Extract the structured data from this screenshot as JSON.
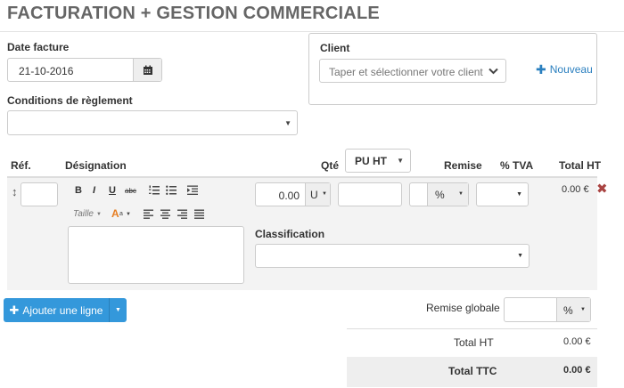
{
  "header": {
    "title": "FACTURATION + GESTION COMMERCIALE"
  },
  "invoice": {
    "date_label": "Date facture",
    "date_value": "21-10-2016",
    "conditions_label": "Conditions de règlement",
    "conditions_value": ""
  },
  "client": {
    "label": "Client",
    "placeholder": "Taper et sélectionner votre client",
    "new_link": "Nouveau"
  },
  "table": {
    "headers": {
      "ref": "Réf.",
      "designation": "Désignation",
      "qty": "Qté",
      "pu_select": "PU HT",
      "remise": "Remise",
      "tva": "% TVA",
      "total": "Total HT"
    }
  },
  "line": {
    "ref": "",
    "editor": {
      "bold": "B",
      "italic": "I",
      "underline": "U",
      "strike": "abc",
      "size": "Taille"
    },
    "price": "0.00",
    "unit": "U",
    "qty": "",
    "remise_value": "",
    "remise_unit": "%",
    "tva": "",
    "total": "0.00 €",
    "classification_label": "Classification",
    "classification_value": ""
  },
  "actions": {
    "add_line": "Ajouter une ligne"
  },
  "totals": {
    "remise_globale_label": "Remise globale",
    "remise_globale_value": "",
    "remise_globale_unit": "%",
    "total_ht_label": "Total HT",
    "total_ht_value": "0.00 €",
    "total_ttc_label": "Total TTC",
    "total_ttc_value": "0.00 €"
  },
  "colors": {
    "primary": "#3498db",
    "link": "#2a7fbf",
    "delete": "#a94442"
  }
}
